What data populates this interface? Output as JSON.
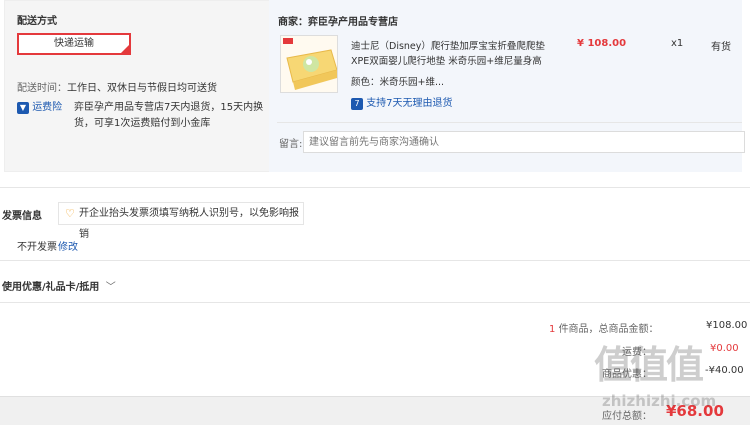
{
  "shipping": {
    "title": "配送方式",
    "method_label": "快递运输",
    "time_label": "配送时间：",
    "time_value": "工作日、双休日与节假日均可送货",
    "insurance_label": "运费险",
    "insurance_text_1": "弈臣孕产用品专营店7天内退货，15天内换",
    "insurance_text_2": "货，可享1次运费赔付到小金库"
  },
  "merchant": {
    "label": "商家：弈臣孕产用品专营店",
    "product": {
      "title_line1": "迪士尼（Disney）爬行垫加厚宝宝折叠爬爬垫",
      "title_line2": "XPE双面婴儿爬行地垫 米奇乐园+维尼量身高",
      "color_label": "颜色：米奇乐园+维...",
      "return_text": "支持7天无理由退货",
      "price": "¥ 108.00",
      "qty": "x1",
      "stock": "有货"
    },
    "message_label": "留言:",
    "message_placeholder": "建议留言前先与商家沟通确认"
  },
  "invoice": {
    "title": "发票信息",
    "hint": "开企业抬头发票须填写纳税人识别号，以免影响报销",
    "status": "不开发票",
    "edit_link": "修改"
  },
  "coupon": {
    "title": "使用优惠/礼品卡/抵用"
  },
  "summary": {
    "count": "1",
    "count_suffix": "件商品，总商品金额：",
    "goods_total": "¥108.00",
    "freight_label": "运费：",
    "freight_value": "¥0.00",
    "discount_label": "商品优惠：",
    "discount_value": "-¥40.00",
    "payable_label": "应付总额：",
    "payable_value": "¥68.00"
  },
  "watermark": {
    "chars": "值值值",
    "url": "zhizhizhi.com"
  },
  "colors": {
    "accent": "#e4393c",
    "link": "#1d59b0"
  }
}
